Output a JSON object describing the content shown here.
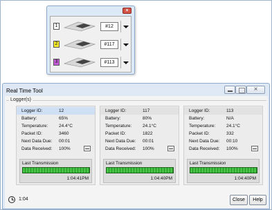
{
  "mini_window": {
    "rows": [
      {
        "index": "1",
        "id": "#12",
        "color": "#ffffff"
      },
      {
        "index": "2",
        "id": "#117",
        "color": "#f4ea2a"
      },
      {
        "index": "3",
        "id": "#113",
        "color": "#c45ad6"
      }
    ]
  },
  "window": {
    "title": "Real Time Tool",
    "group_label": "Logger(s)"
  },
  "labels": {
    "logger_id": "Logger ID:",
    "battery": "Battery:",
    "temperature": "Temperature:",
    "packet_id": "Packet ID:",
    "next_data_due": "Next Data Due:",
    "data_received": "Data Received:",
    "last_transmission": "Last Transmission"
  },
  "loggers": [
    {
      "logger_id": "12",
      "battery": "65%",
      "temperature": "24.4°C",
      "packet_id": "3460",
      "next_data_due": "00:01",
      "data_received": "100%",
      "last_time": "1:04:41PM",
      "bar_fraction": 1.0
    },
    {
      "logger_id": "117",
      "battery": "80%",
      "temperature": "24.1°C",
      "packet_id": "1822",
      "next_data_due": "00:01",
      "data_received": "100%",
      "last_time": "1:04:40PM",
      "bar_fraction": 1.0
    },
    {
      "logger_id": "113",
      "battery": "N/A",
      "temperature": "24.1°C",
      "packet_id": "332",
      "next_data_due": "00:10",
      "data_received": "100%",
      "last_time": "1:04:40PM",
      "bar_fraction": 1.0
    }
  ],
  "status_bar": {
    "time": "1:04",
    "close_label": "Close",
    "help_label": "Help"
  },
  "colors": {
    "accent": "#cfe0f5",
    "bar_green": "#43c443"
  }
}
